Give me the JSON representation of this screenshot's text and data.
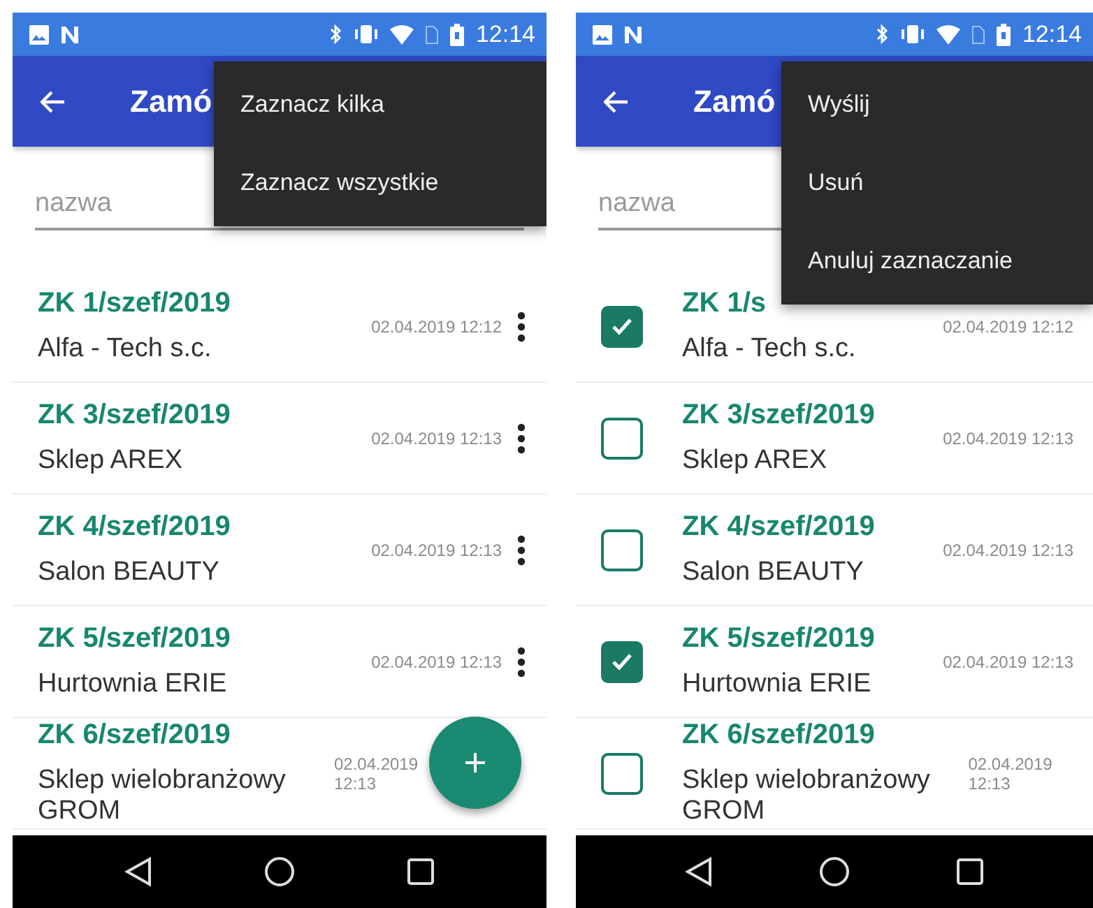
{
  "screens": [
    {
      "time": "12:14",
      "title": "Zamó",
      "search": {
        "placeholder": "nazwa"
      },
      "menu": [
        "Zaznacz kilka",
        "Zaznacz wszystkie"
      ],
      "fab": true,
      "rows": [
        {
          "number": "ZK 1/szef/2019",
          "customer": "Alfa - Tech s.c.",
          "date": "02.04.2019 12:12"
        },
        {
          "number": "ZK 3/szef/2019",
          "customer": "Sklep AREX",
          "date": "02.04.2019 12:13"
        },
        {
          "number": "ZK 4/szef/2019",
          "customer": "Salon BEAUTY",
          "date": "02.04.2019 12:13"
        },
        {
          "number": "ZK 5/szef/2019",
          "customer": "Hurtownia ERIE",
          "date": "02.04.2019 12:13"
        },
        {
          "number": "ZK 6/szef/2019",
          "customer": "Sklep wielobranżowy GROM",
          "date": "02.04.2019 12:13"
        }
      ]
    },
    {
      "time": "12:14",
      "title": "Zamó",
      "search": {
        "placeholder": "nazwa"
      },
      "menu": [
        "Wyślij",
        "Usuń",
        "Anuluj zaznaczanie"
      ],
      "rows": [
        {
          "number": "ZK 1/s",
          "customer": "Alfa - Tech s.c.",
          "date": "02.04.2019 12:12",
          "checked": true
        },
        {
          "number": "ZK 3/szef/2019",
          "customer": "Sklep AREX",
          "date": "02.04.2019 12:13",
          "checked": false
        },
        {
          "number": "ZK 4/szef/2019",
          "customer": "Salon BEAUTY",
          "date": "02.04.2019 12:13",
          "checked": false
        },
        {
          "number": "ZK 5/szef/2019",
          "customer": "Hurtownia ERIE",
          "date": "02.04.2019 12:13",
          "checked": true
        },
        {
          "number": "ZK 6/szef/2019",
          "customer": "Sklep wielobranżowy GROM",
          "date": "02.04.2019 12:13",
          "checked": false
        }
      ]
    }
  ]
}
